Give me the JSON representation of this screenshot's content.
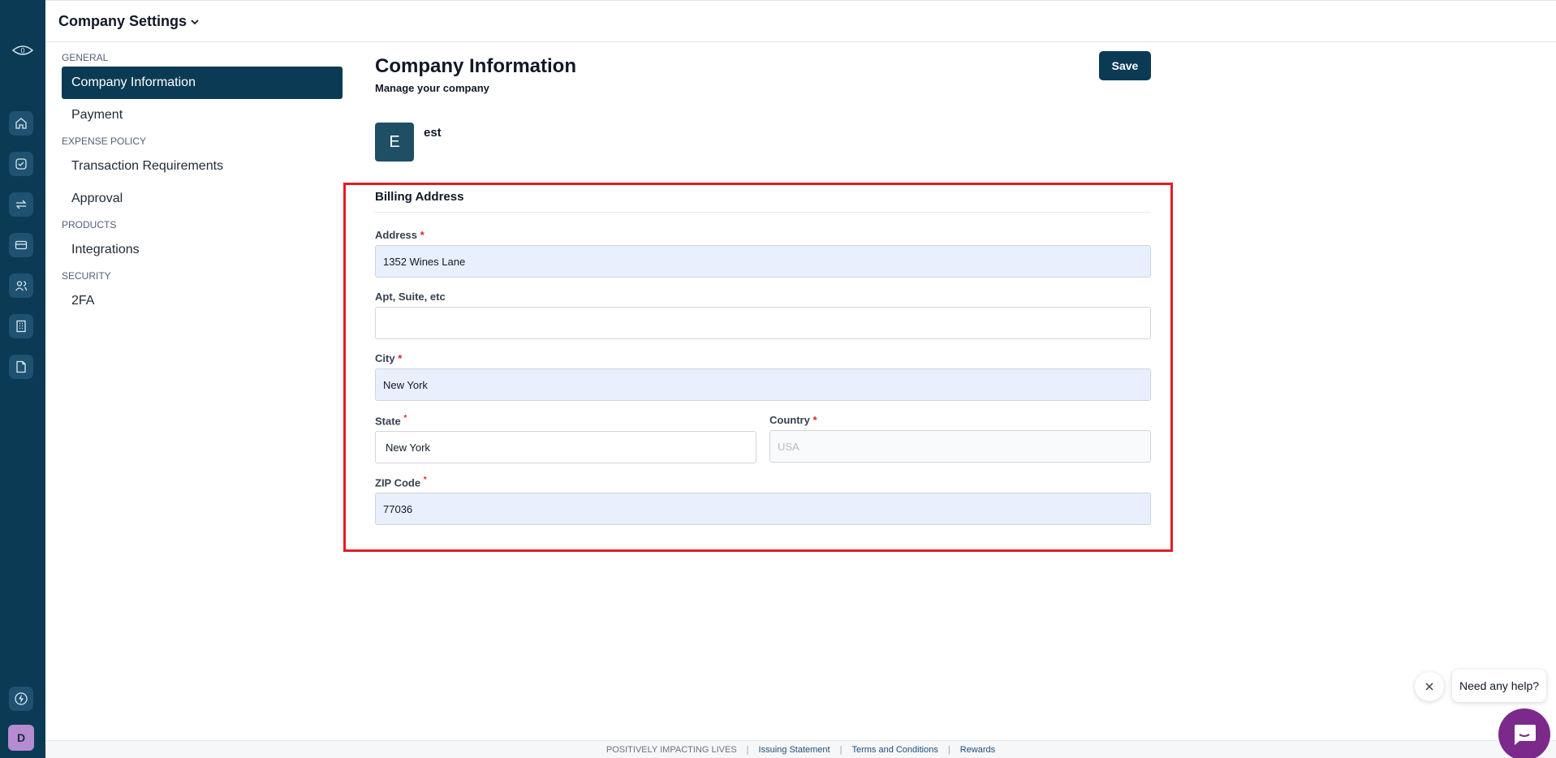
{
  "topbar": {
    "title": "Company Settings"
  },
  "rail": {
    "icons": [
      "logo-icon",
      "home-icon",
      "approvals-icon",
      "transfers-icon",
      "cards-icon",
      "people-icon",
      "company-icon",
      "document-icon",
      "power-icon"
    ],
    "avatar_initial": "D",
    "logo_text": "0"
  },
  "settings_nav": {
    "sections": [
      {
        "label": "GENERAL",
        "items": [
          "Company Information",
          "Payment"
        ]
      },
      {
        "label": "EXPENSE POLICY",
        "items": [
          "Transaction Requirements",
          "Approval"
        ]
      },
      {
        "label": "PRODUCTS",
        "items": [
          "Integrations"
        ]
      },
      {
        "label": "SECURITY",
        "items": [
          "2FA"
        ]
      }
    ],
    "active_item": "Company Information"
  },
  "main": {
    "title": "Company Information",
    "subtitle": "Manage your company",
    "save_label": "Save",
    "company_initial": "E",
    "company_name": "est"
  },
  "billing": {
    "title": "Billing Address",
    "address": {
      "label": "Address",
      "required": "*",
      "value": "1352 Wines Lane"
    },
    "apt": {
      "label": "Apt, Suite, etc",
      "value": ""
    },
    "city": {
      "label": "City",
      "required": "*",
      "value": "New York"
    },
    "state": {
      "label": "State",
      "required": "*",
      "value": "New York"
    },
    "country": {
      "label": "Country",
      "required": "*",
      "placeholder": "USA"
    },
    "zip": {
      "label": "ZIP Code",
      "required": "*",
      "value": "77036"
    }
  },
  "footer": {
    "tagline": "POSITIVELY IMPACTING LIVES",
    "links": [
      "Issuing Statement",
      "Terms and Conditions",
      "Rewards"
    ],
    "separator": "|"
  },
  "help": {
    "bubble_text": "Need any help?"
  },
  "colors": {
    "brand": "#0b3a55",
    "highlight_frame": "#e01e24",
    "filled_input": "#e8f0fe",
    "help_launcher": "#7b2a8c"
  }
}
